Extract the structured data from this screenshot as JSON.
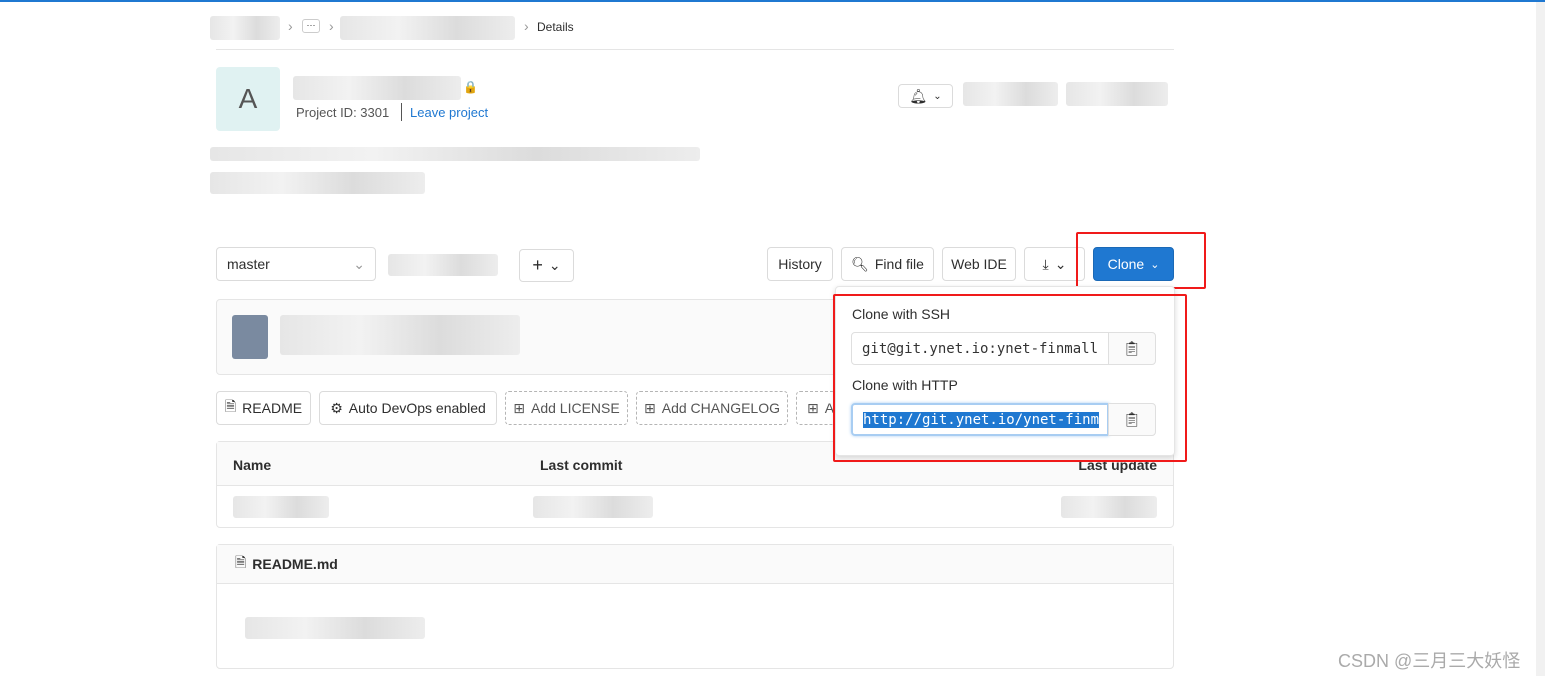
{
  "breadcrumb": {
    "current": "Details",
    "more": "···"
  },
  "project": {
    "avatar_letter": "A",
    "id_label": "Project ID: 3301",
    "leave_label": "Leave project"
  },
  "toolbar": {
    "branch": "master",
    "plus": "+",
    "history": "History",
    "find_file": "Find file",
    "web_ide": "Web IDE",
    "clone": "Clone"
  },
  "clone_dropdown": {
    "ssh_label": "Clone with SSH",
    "ssh_url": "git@git.ynet.io:ynet-finmall",
    "http_label": "Clone with HTTP",
    "http_url": "http://git.ynet.io/ynet-finm"
  },
  "badges": [
    "README",
    "Auto DevOps enabled",
    "Add LICENSE",
    "Add CHANGELOG",
    "A"
  ],
  "table": {
    "headers": [
      "Name",
      "Last commit",
      "Last update"
    ]
  },
  "readme": {
    "title": "README.md"
  },
  "watermark": "CSDN @三月三大妖怪",
  "colors": {
    "primary": "#1f78d1",
    "annotation": "#f01a1a"
  }
}
